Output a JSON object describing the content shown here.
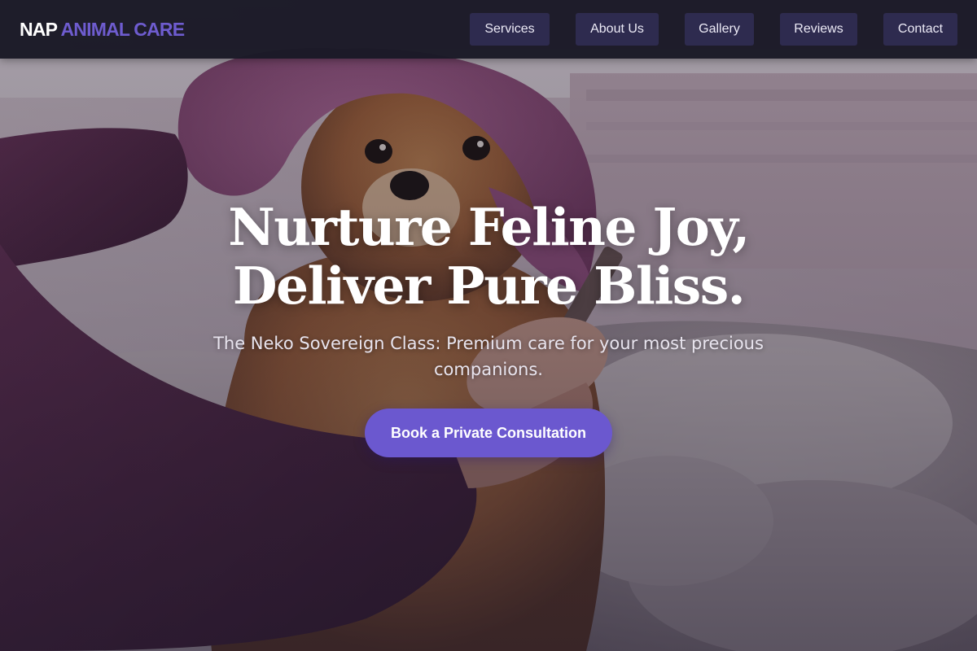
{
  "navbar": {
    "brand_primary": "NAP",
    "brand_accent": "ANIMAL CARE",
    "links": [
      {
        "label": "Services"
      },
      {
        "label": "About Us"
      },
      {
        "label": "Gallery"
      },
      {
        "label": "Reviews"
      },
      {
        "label": "Contact"
      }
    ]
  },
  "hero": {
    "title_line_1": "Nurture Feline Joy,",
    "title_line_2": "Deliver Pure Bliss.",
    "subtitle": "The Neko Sovereign Class: Premium care for your most precious companions.",
    "cta_label": "Book a Private Consultation",
    "background_image": "dog-wrapped-in-pink-towel-being-groomed-photo"
  },
  "colors": {
    "navbar_bg": "#1a1926",
    "nav_button_bg": "#2e2b4f",
    "brand_accent": "#6e5ccf",
    "cta_bg": "#6b58cf",
    "text_light": "#ffffff"
  }
}
